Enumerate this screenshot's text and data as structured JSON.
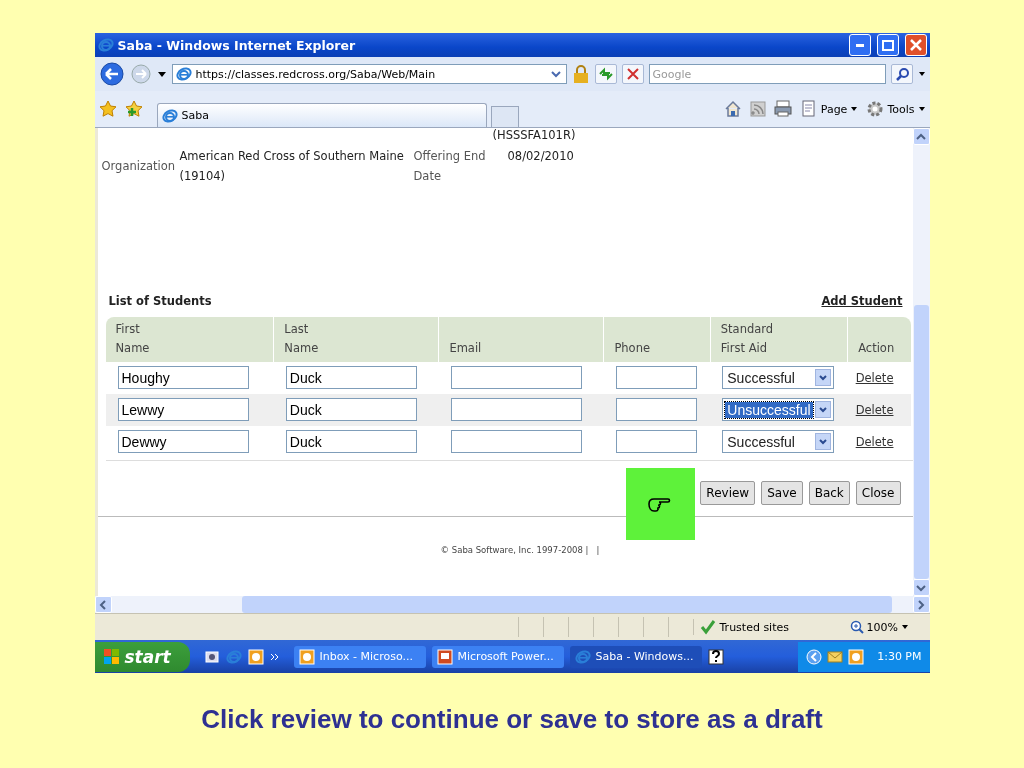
{
  "window": {
    "title": "Saba - Windows Internet Explorer"
  },
  "address_bar": {
    "url": "https://classes.redcross.org/Saba/Web/Main",
    "search_placeholder": "Google"
  },
  "tabs": [
    {
      "label": "Saba",
      "selected": true
    }
  ],
  "command_bar": [
    "Page",
    "Tools"
  ],
  "details": {
    "cut_text": "(HSSSFA101R)",
    "fields": [
      {
        "label": "Organization",
        "value": "American Red Cross of Southern Maine (19104)"
      },
      {
        "label": "Offering End Date",
        "value": "08/02/2010"
      }
    ]
  },
  "students": {
    "title": "List of Students",
    "add_link": "Add Student",
    "columns": [
      "First Name",
      "Last Name",
      "Email",
      "Phone",
      "Standard First Aid",
      "Action"
    ],
    "rows": [
      {
        "first": "Houghy",
        "last": "Duck",
        "result": "Successful",
        "focused": false,
        "action": "Delete"
      },
      {
        "first": "Lewwy",
        "last": "Duck",
        "result": "Unsuccessful",
        "focused": true,
        "action": "Delete"
      },
      {
        "first": "Dewwy",
        "last": "Duck",
        "result": "Successful",
        "focused": false,
        "action": "Delete"
      }
    ]
  },
  "buttons": [
    "Review",
    "Save",
    "Back",
    "Close"
  ],
  "footer": "© Saba Software, Inc. 1997-2008 |   |",
  "status_bar": {
    "zone": "Trusted sites",
    "zoom": "100%"
  },
  "taskbar": {
    "start": "start",
    "tasks": [
      {
        "label": "Inbox - Microso...",
        "kind": "mail",
        "selected": false
      },
      {
        "label": "Microsoft Power...",
        "kind": "slides",
        "selected": false
      },
      {
        "label": "Saba - Windows...",
        "kind": "browser",
        "selected": true
      }
    ],
    "clock": "1:30 PM"
  },
  "caption": "Click review to continue or save to store as a draft"
}
